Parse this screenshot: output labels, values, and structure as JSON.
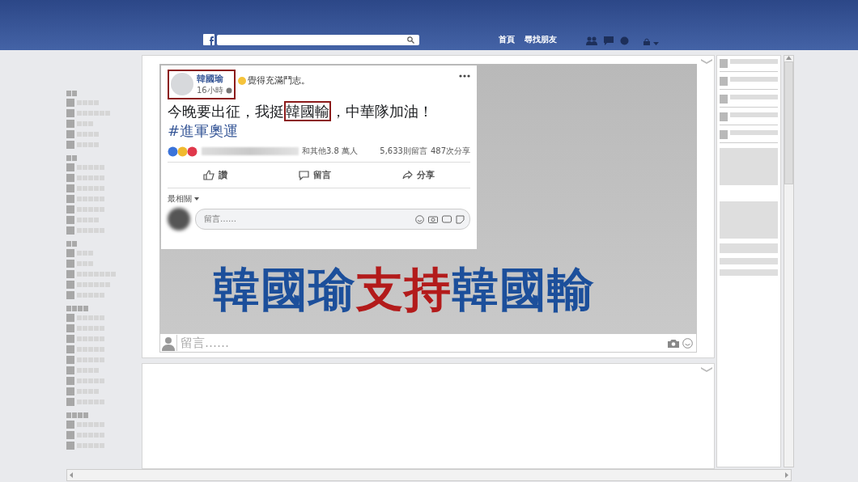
{
  "top_bar": {
    "nav": [
      "首頁",
      "尋找朋友"
    ]
  },
  "post": {
    "author": "韓國瑜",
    "feeling": "覺得充滿鬥志。",
    "time": "16小時",
    "body": [
      {
        "text": "今晚要出征，我挺",
        "highlighted": false
      },
      {
        "text": "韓國輸",
        "highlighted": true
      },
      {
        "text": "，中華隊加油！",
        "highlighted": false
      }
    ],
    "author_highlighted": true,
    "hashtag": "#進軍奧運",
    "reactions_others": "和其他3.8 萬人",
    "comments_count": "5,633則留言",
    "shares_count": "487次分享",
    "actions": [
      "讚",
      "留言",
      "分享"
    ],
    "sort": "最相關",
    "comment_placeholder": "留言……"
  },
  "headline": [
    {
      "text": "韓國瑜",
      "emphasis": false
    },
    {
      "text": "支持",
      "emphasis": true
    },
    {
      "text": "韓國輸",
      "emphasis": false
    }
  ],
  "comment_bar": {
    "placeholder": "留言……"
  }
}
